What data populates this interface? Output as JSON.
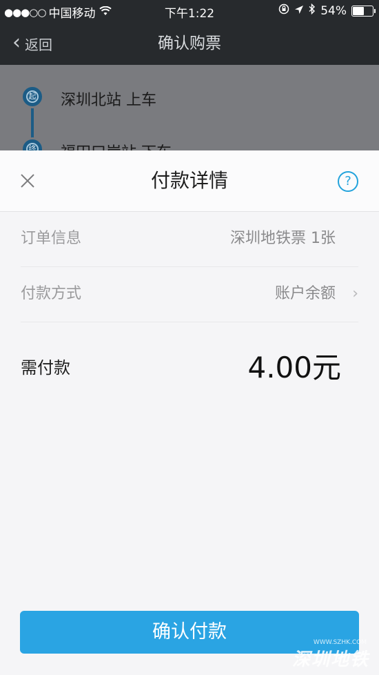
{
  "status_bar": {
    "signal": "●●●○○",
    "carrier": "中国移动",
    "time": "下午1:22",
    "battery": "54%",
    "icons": [
      "wifi-icon",
      "lock-rotation-icon",
      "location-arrow-icon",
      "bluetooth-icon",
      "battery-icon"
    ]
  },
  "nav": {
    "back_label": "返回",
    "title": "确认购票"
  },
  "route": {
    "start_marker": "起",
    "start_station": "深圳北站 上车",
    "end_marker": "终",
    "end_station": "福田口岸站 下车"
  },
  "sheet": {
    "title": "付款详情",
    "help": "?",
    "order_label": "订单信息",
    "order_value": "深圳地铁票 1张",
    "payment_label": "付款方式",
    "payment_value": "账户余额",
    "payment_arrow": "›",
    "amount_label": "需付款",
    "amount_value": "4.00元",
    "confirm_label": "确认付款"
  },
  "watermark": {
    "text": "深圳地铁",
    "url": "WWW.SZHK.COM"
  },
  "colors": {
    "accent": "#2aa4e3",
    "nav_background": "#272a2d",
    "route_color": "#1c5c86"
  }
}
